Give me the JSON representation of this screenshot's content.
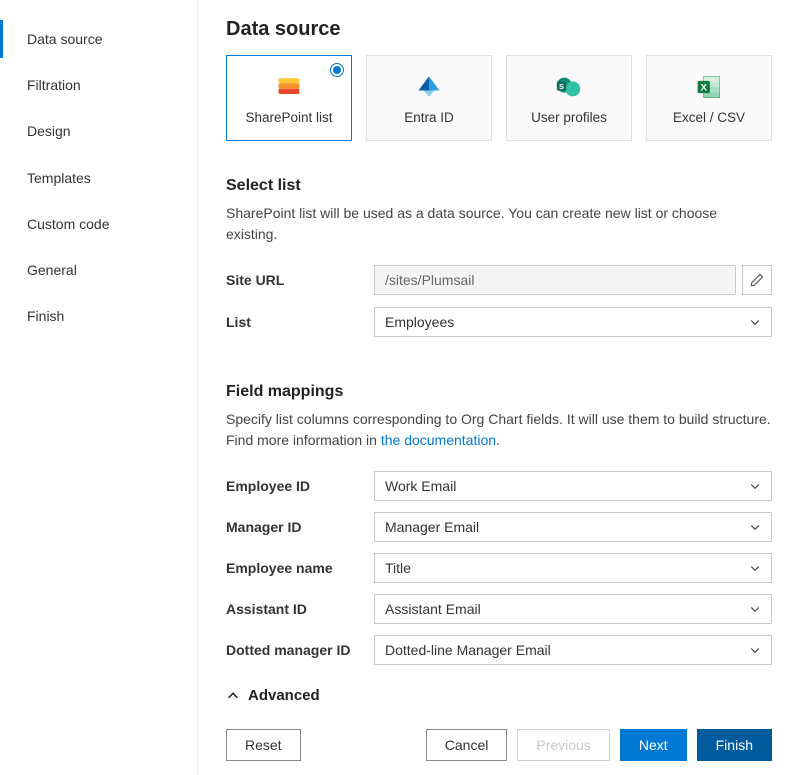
{
  "sidebar": {
    "items": [
      {
        "label": "Data source",
        "active": true
      },
      {
        "label": "Filtration",
        "active": false
      },
      {
        "label": "Design",
        "active": false
      },
      {
        "label": "Templates",
        "active": false
      },
      {
        "label": "Custom code",
        "active": false
      },
      {
        "label": "General",
        "active": false
      },
      {
        "label": "Finish",
        "active": false
      }
    ]
  },
  "main": {
    "title": "Data source",
    "sources": [
      {
        "key": "sharepoint",
        "label": "SharePoint list",
        "selected": true
      },
      {
        "key": "entra",
        "label": "Entra ID",
        "selected": false
      },
      {
        "key": "userprofiles",
        "label": "User profiles",
        "selected": false
      },
      {
        "key": "excel",
        "label": "Excel / CSV",
        "selected": false
      }
    ],
    "select_list": {
      "title": "Select list",
      "desc": "SharePoint list will be used as a data source. You can create new list or choose existing.",
      "site_url_label": "Site URL",
      "site_url_value": "/sites/Plumsail",
      "list_label": "List",
      "list_value": "Employees"
    },
    "field_mappings": {
      "title": "Field mappings",
      "desc_prefix": "Specify list columns corresponding to Org Chart fields. It will use them to build structure. Find more information in ",
      "desc_link": "the documentation",
      "desc_suffix": ".",
      "rows": [
        {
          "label": "Employee ID",
          "value": "Work Email"
        },
        {
          "label": "Manager ID",
          "value": "Manager Email"
        },
        {
          "label": "Employee name",
          "value": "Title"
        },
        {
          "label": "Assistant ID",
          "value": "Assistant Email"
        },
        {
          "label": "Dotted manager ID",
          "value": "Dotted-line Manager Email"
        }
      ]
    },
    "advanced_label": "Advanced"
  },
  "footer": {
    "reset": "Reset",
    "cancel": "Cancel",
    "previous": "Previous",
    "next": "Next",
    "finish": "Finish"
  }
}
